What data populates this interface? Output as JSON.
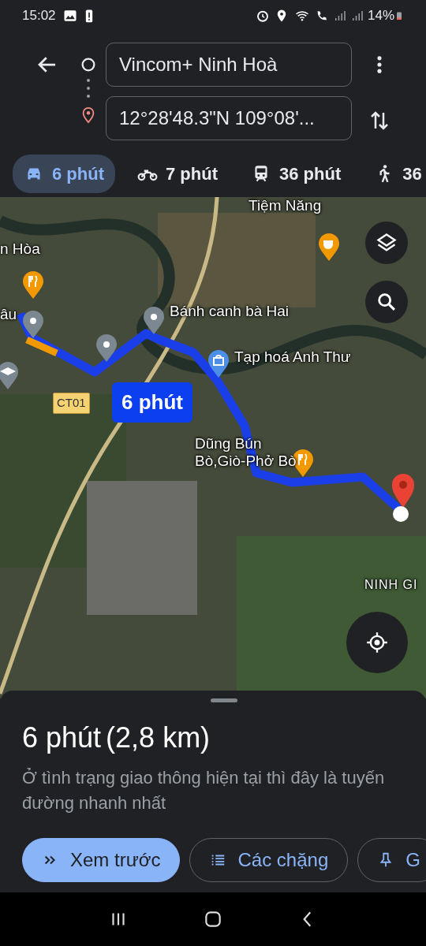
{
  "status_bar": {
    "time": "15:02",
    "battery": "14%"
  },
  "origin": {
    "value": "Vincom+ Ninh Hoà"
  },
  "destination": {
    "value": "12°28'48.3\"N 109°08'..."
  },
  "modes": [
    {
      "kind": "car",
      "label": "6 phút",
      "selected": true
    },
    {
      "kind": "motorbike",
      "label": "7 phút",
      "selected": false
    },
    {
      "kind": "transit",
      "label": "36 phút",
      "selected": false
    },
    {
      "kind": "walk",
      "label": "36",
      "selected": false
    }
  ],
  "map": {
    "labels": [
      "Tiệm Năng",
      "n Hòa",
      "âu",
      "Bánh canh bà Hai",
      "Tạp hoá Anh Thư",
      "Dũng Bún\nBò,Giò-Phở Bò",
      "NINH GI"
    ],
    "road_sign": "CT01",
    "route_label": "6 phút"
  },
  "summary": {
    "duration": "6 phút",
    "distance": "(2,8 km)",
    "note": "Ở tình trạng giao thông hiện tại thì đây là tuyến đường nhanh nhất"
  },
  "actions": [
    {
      "kind": "preview",
      "label": "Xem trước",
      "filled": true
    },
    {
      "kind": "steps",
      "label": "Các chặng",
      "filled": false
    },
    {
      "kind": "pin",
      "label": "G",
      "filled": false
    }
  ]
}
